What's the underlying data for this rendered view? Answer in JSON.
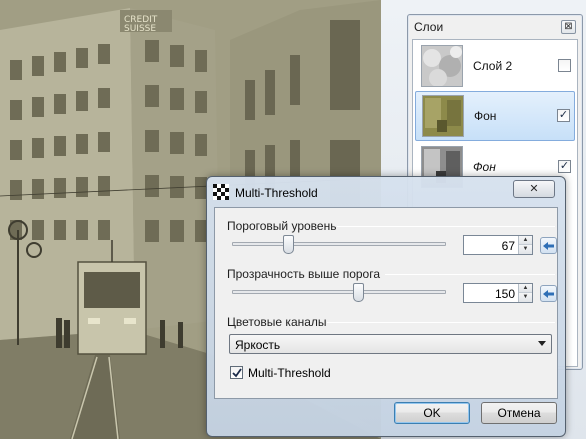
{
  "layers_panel": {
    "title": "Слои",
    "close_glyph": "⊠",
    "layers": [
      {
        "name": "Слой 2",
        "visible": true,
        "selected": false,
        "thumbnail": "clouds-thumbnail",
        "check": ""
      },
      {
        "name": "Фон",
        "visible": true,
        "selected": true,
        "thumbnail": "street-olive-thumbnail",
        "check": "✓"
      },
      {
        "name": "Фон",
        "visible": true,
        "selected": false,
        "thumbnail": "street-bw-thumbnail",
        "check": "✓"
      }
    ]
  },
  "dialog": {
    "title": "Multi-Threshold",
    "close_glyph": "✕",
    "threshold": {
      "label": "Пороговый уровень",
      "value": "67",
      "max": 255
    },
    "transparency": {
      "label": "Прозрачность выше порога",
      "value": "150",
      "max": 255
    },
    "channels": {
      "label": "Цветовые каналы",
      "selected": "Яркость"
    },
    "multi_threshold_checkbox": {
      "label": "Multi-Threshold",
      "checked": true
    },
    "ok_label": "OK",
    "cancel_label": "Отмена"
  },
  "colors": {
    "photo_tint": "#9d9a80",
    "selection": "#c7e0f8",
    "dialog_frame": "#c4d2e2",
    "reset_arrow": "#2f6fb6"
  }
}
